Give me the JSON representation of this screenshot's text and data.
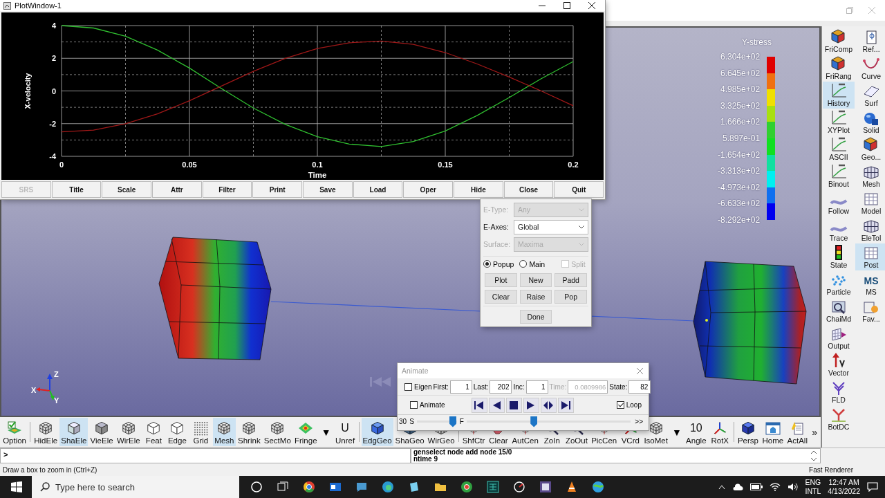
{
  "plot_window": {
    "title": "PlotWindow-1",
    "chart_data": {
      "type": "line",
      "xlabel": "Time",
      "ylabel": "X-velocity",
      "x": [
        0,
        0.0125,
        0.025,
        0.0375,
        0.05,
        0.0625,
        0.075,
        0.0875,
        0.1,
        0.1125,
        0.125,
        0.1375,
        0.15,
        0.1625,
        0.175,
        0.1875,
        0.2
      ],
      "xlim": [
        0,
        0.2
      ],
      "ylim": [
        -4,
        4
      ],
      "xticks": [
        0,
        0.05,
        0.1,
        0.15,
        0.2
      ],
      "yticks": [
        -4,
        -2,
        0,
        2,
        4
      ],
      "grid": true,
      "series": [
        {
          "color": "#30c030",
          "values": [
            4,
            3.85,
            3.35,
            2.5,
            1.4,
            0.15,
            -1.05,
            -2.05,
            -2.8,
            -3.25,
            -3.4,
            -3.1,
            -2.45,
            -1.5,
            -0.4,
            0.75,
            1.8
          ]
        },
        {
          "color": "#a01818",
          "values": [
            -2.5,
            -2.4,
            -2.0,
            -1.4,
            -0.6,
            0.3,
            1.2,
            2.0,
            2.6,
            2.95,
            3.05,
            2.85,
            2.35,
            1.65,
            0.85,
            0.0,
            -0.9
          ]
        }
      ]
    },
    "buttons": [
      {
        "label": "SRS",
        "disabled": true
      },
      {
        "label": "Title",
        "disabled": false
      },
      {
        "label": "Scale",
        "disabled": false
      },
      {
        "label": "Attr",
        "disabled": false
      },
      {
        "label": "Filter",
        "disabled": false
      },
      {
        "label": "Print",
        "disabled": false
      },
      {
        "label": "Save",
        "disabled": false
      },
      {
        "label": "Load",
        "disabled": false
      },
      {
        "label": "Oper",
        "disabled": false
      },
      {
        "label": "Hide",
        "disabled": false
      },
      {
        "label": "Close",
        "disabled": false
      },
      {
        "label": "Quit",
        "disabled": false
      }
    ]
  },
  "viewport": {
    "legend": {
      "title": "Y-stress",
      "labels": [
        "6.304e+02",
        "6.645e+02",
        "4.985e+02",
        "3.325e+02",
        "1.666e+02",
        "5.897e-01",
        "-1.654e+02",
        "-3.313e+02",
        "-4.973e+02",
        "-6.633e+02",
        "-8.292e+02"
      ],
      "bands": [
        {
          "color": "#e00000"
        },
        {
          "color": "#f07010"
        },
        {
          "color": "#f0e000"
        },
        {
          "color": "#a8e010"
        },
        {
          "color": "#30d030"
        },
        {
          "color": "#10e020"
        },
        {
          "color": "#10e0a0"
        },
        {
          "color": "#00f0f0"
        },
        {
          "color": "#1070f0"
        },
        {
          "color": "#0000f0"
        }
      ]
    },
    "axis_labels": [
      "Z",
      "X",
      "Y"
    ]
  },
  "plot_panel": {
    "fields": [
      {
        "label": "E-Type:",
        "value": "Any",
        "disabled": true
      },
      {
        "label": "E-Axes:",
        "value": "Global",
        "disabled": false
      },
      {
        "label": "Surface:",
        "value": "Maxima",
        "disabled": true
      }
    ],
    "radios": [
      {
        "label": "Popup",
        "selected": true
      },
      {
        "label": "Main",
        "selected": false
      }
    ],
    "split": {
      "label": "Split",
      "checked": false,
      "disabled": true
    },
    "buttons": [
      "Plot",
      "New",
      "Padd",
      "Clear",
      "Raise",
      "Pop"
    ],
    "done": "Done"
  },
  "animate": {
    "title": "Animate",
    "eigen": {
      "label": "Eigen",
      "checked": false
    },
    "fields": [
      {
        "label": "First:",
        "value": "1",
        "disabled": false
      },
      {
        "label": "Last:",
        "value": "202",
        "disabled": false
      },
      {
        "label": "Inc:",
        "value": "1",
        "disabled": false
      },
      {
        "label": "Time:",
        "value": "0.0809986",
        "disabled": true
      },
      {
        "label": "State:",
        "value": "82",
        "disabled": false
      }
    ],
    "animate": {
      "label": "Animate",
      "checked": false
    },
    "loop": {
      "label": "Loop",
      "checked": true
    },
    "speed": {
      "value": "30",
      "slow": "S",
      "fast": "F",
      "level": 0.9
    },
    "timeline": {
      "level": 0.41
    },
    "more": ">>"
  },
  "toolbar": {
    "items": [
      {
        "kind": "button",
        "label": "Option",
        "selected": false
      },
      {
        "kind": "separator"
      },
      {
        "kind": "button",
        "label": "HidEle",
        "selected": false
      },
      {
        "kind": "button",
        "label": "ShaEle",
        "selected": true
      },
      {
        "kind": "button",
        "label": "VieEle",
        "selected": false
      },
      {
        "kind": "button",
        "label": "WirEle",
        "selected": false
      },
      {
        "kind": "button",
        "label": "Feat",
        "selected": false
      },
      {
        "kind": "button",
        "label": "Edge",
        "selected": false
      },
      {
        "kind": "button",
        "label": "Grid",
        "selected": false
      },
      {
        "kind": "button",
        "label": "Mesh",
        "selected": true
      },
      {
        "kind": "button",
        "label": "Shrink",
        "selected": false
      },
      {
        "kind": "button",
        "label": "SectMo",
        "selected": false
      },
      {
        "kind": "button",
        "label": "Fringe",
        "selected": false
      },
      {
        "kind": "dropdown",
        "label": "▼"
      },
      {
        "kind": "glyph",
        "label": "Unref",
        "glyph": "U",
        "selected": false
      },
      {
        "kind": "separator"
      },
      {
        "kind": "button",
        "label": "EdgGeo",
        "selected": true
      },
      {
        "kind": "button",
        "label": "ShaGeo",
        "selected": false
      },
      {
        "kind": "button",
        "label": "WirGeo",
        "selected": false
      },
      {
        "kind": "separator"
      },
      {
        "kind": "button",
        "label": "ShfCtr",
        "selected": false
      },
      {
        "kind": "button",
        "label": "Clear",
        "selected": false
      },
      {
        "kind": "button",
        "label": "AutCen",
        "selected": false
      },
      {
        "kind": "button",
        "label": "ZoIn",
        "selected": false
      },
      {
        "kind": "button",
        "label": "ZoOut",
        "selected": false
      },
      {
        "kind": "button",
        "label": "PicCen",
        "selected": false
      },
      {
        "kind": "button",
        "label": "VCrd",
        "selected": false
      },
      {
        "kind": "button",
        "label": "IsoMet",
        "selected": false
      },
      {
        "kind": "dropdown",
        "label": "▼"
      },
      {
        "kind": "glyph",
        "label": "Angle",
        "glyph": "10",
        "selected": false
      },
      {
        "kind": "button",
        "label": "RotX",
        "selected": false
      },
      {
        "kind": "separator"
      },
      {
        "kind": "button",
        "label": "Persp",
        "selected": false
      },
      {
        "kind": "button",
        "label": "Home",
        "selected": false
      },
      {
        "kind": "button",
        "label": "ActAll",
        "selected": false
      },
      {
        "kind": "dropdown",
        "label": "»"
      }
    ]
  },
  "side_panel": {
    "columns": [
      [
        {
          "label": "FriComp",
          "selected": false
        },
        {
          "label": "FriRang",
          "selected": false
        },
        {
          "label": "History",
          "selected": true
        },
        {
          "label": "XYPlot",
          "selected": false
        },
        {
          "label": "ASCII",
          "selected": false
        },
        {
          "label": "Binout",
          "selected": false
        },
        {
          "label": "Follow",
          "selected": false
        },
        {
          "label": "Trace",
          "selected": false
        },
        {
          "label": "State",
          "selected": false
        },
        {
          "label": "Particle",
          "selected": false
        },
        {
          "label": "ChaiMd",
          "selected": false
        },
        {
          "label": "Output",
          "selected": false
        },
        {
          "label": "Vector",
          "selected": false
        },
        {
          "label": "FLD",
          "selected": false
        },
        {
          "label": "BotDC",
          "selected": false
        }
      ],
      [
        {
          "label": "Ref...",
          "selected": false
        },
        {
          "label": "Curve",
          "selected": false
        },
        {
          "label": "Surf",
          "selected": false
        },
        {
          "label": "Solid",
          "selected": false
        },
        {
          "label": "Geo...",
          "selected": false
        },
        {
          "label": "Mesh",
          "selected": false
        },
        {
          "label": "Model",
          "selected": false
        },
        {
          "label": "EleTol",
          "selected": false
        },
        {
          "label": "Post",
          "selected": true
        },
        {
          "label": "MS",
          "glyph": "MS",
          "selected": false
        },
        {
          "label": "Fav...",
          "selected": false
        }
      ]
    ]
  },
  "command": {
    "prompt": ">",
    "log": [
      "genselect node add node 15/0",
      "ntime 9"
    ]
  },
  "status_bar": {
    "message": "Draw a box to zoom in (Ctrl+Z)",
    "renderer": "Fast Renderer"
  },
  "taskbar": {
    "search": {
      "placeholder": "Type here to search"
    },
    "language": [
      "ENG",
      "INTL"
    ],
    "time": "12:47 AM",
    "date": "4/13/2022"
  }
}
